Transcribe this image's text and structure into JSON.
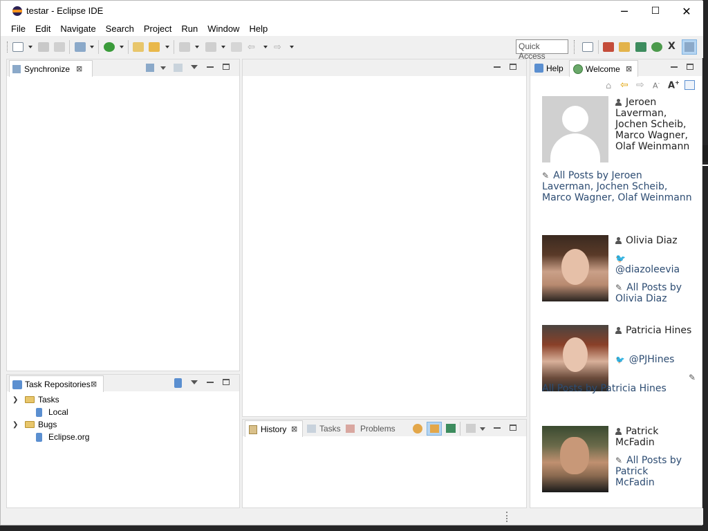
{
  "window": {
    "title": "testar - Eclipse IDE",
    "controls": {
      "minimize": "─",
      "maximize": "☐",
      "close": "✕"
    }
  },
  "menubar": {
    "items": [
      "File",
      "Edit",
      "Navigate",
      "Search",
      "Project",
      "Run",
      "Window",
      "Help"
    ]
  },
  "toolbar": {
    "quick_access": "Quick Access"
  },
  "synchronize_view": {
    "tab_label": "Synchronize"
  },
  "task_repositories_view": {
    "tab_label": "Task Repositories",
    "tree": [
      {
        "label": "Tasks",
        "type": "folder",
        "children": [
          {
            "label": "Local",
            "type": "repo"
          }
        ]
      },
      {
        "label": "Bugs",
        "type": "folder",
        "children": [
          {
            "label": "Eclipse.org",
            "type": "repo"
          }
        ]
      }
    ]
  },
  "bottom_center_view": {
    "tabs": [
      {
        "label": "History",
        "active": true
      },
      {
        "label": "Tasks",
        "active": false
      },
      {
        "label": "Problems",
        "active": false
      }
    ]
  },
  "right_view": {
    "tabs": [
      {
        "label": "Help",
        "active": false
      },
      {
        "label": "Welcome",
        "active": true
      }
    ],
    "authors": [
      {
        "name": "Jeroen Laverman, Jochen Scheib, Marco Wagner, Olaf Weinmann",
        "all_posts": "All Posts by Jeroen Laverman, Jochen Scheib, Marco Wagner, Olaf Weinmann"
      },
      {
        "name": "Olivia Diaz",
        "twitter": "@diazoleevia",
        "all_posts": "All Posts by Olivia Diaz"
      },
      {
        "name": "Patricia Hines",
        "twitter": "@PJHines",
        "all_posts": "All Posts by Patricia Hines"
      },
      {
        "name": "Patrick McFadin",
        "all_posts": "All Posts by Patrick McFadin"
      }
    ]
  },
  "colors": {
    "link": "#2d4c72",
    "panel_bg": "#ffffff",
    "chrome_bg": "#f0f0f0",
    "accent_toggle": "#b5d5f2"
  }
}
